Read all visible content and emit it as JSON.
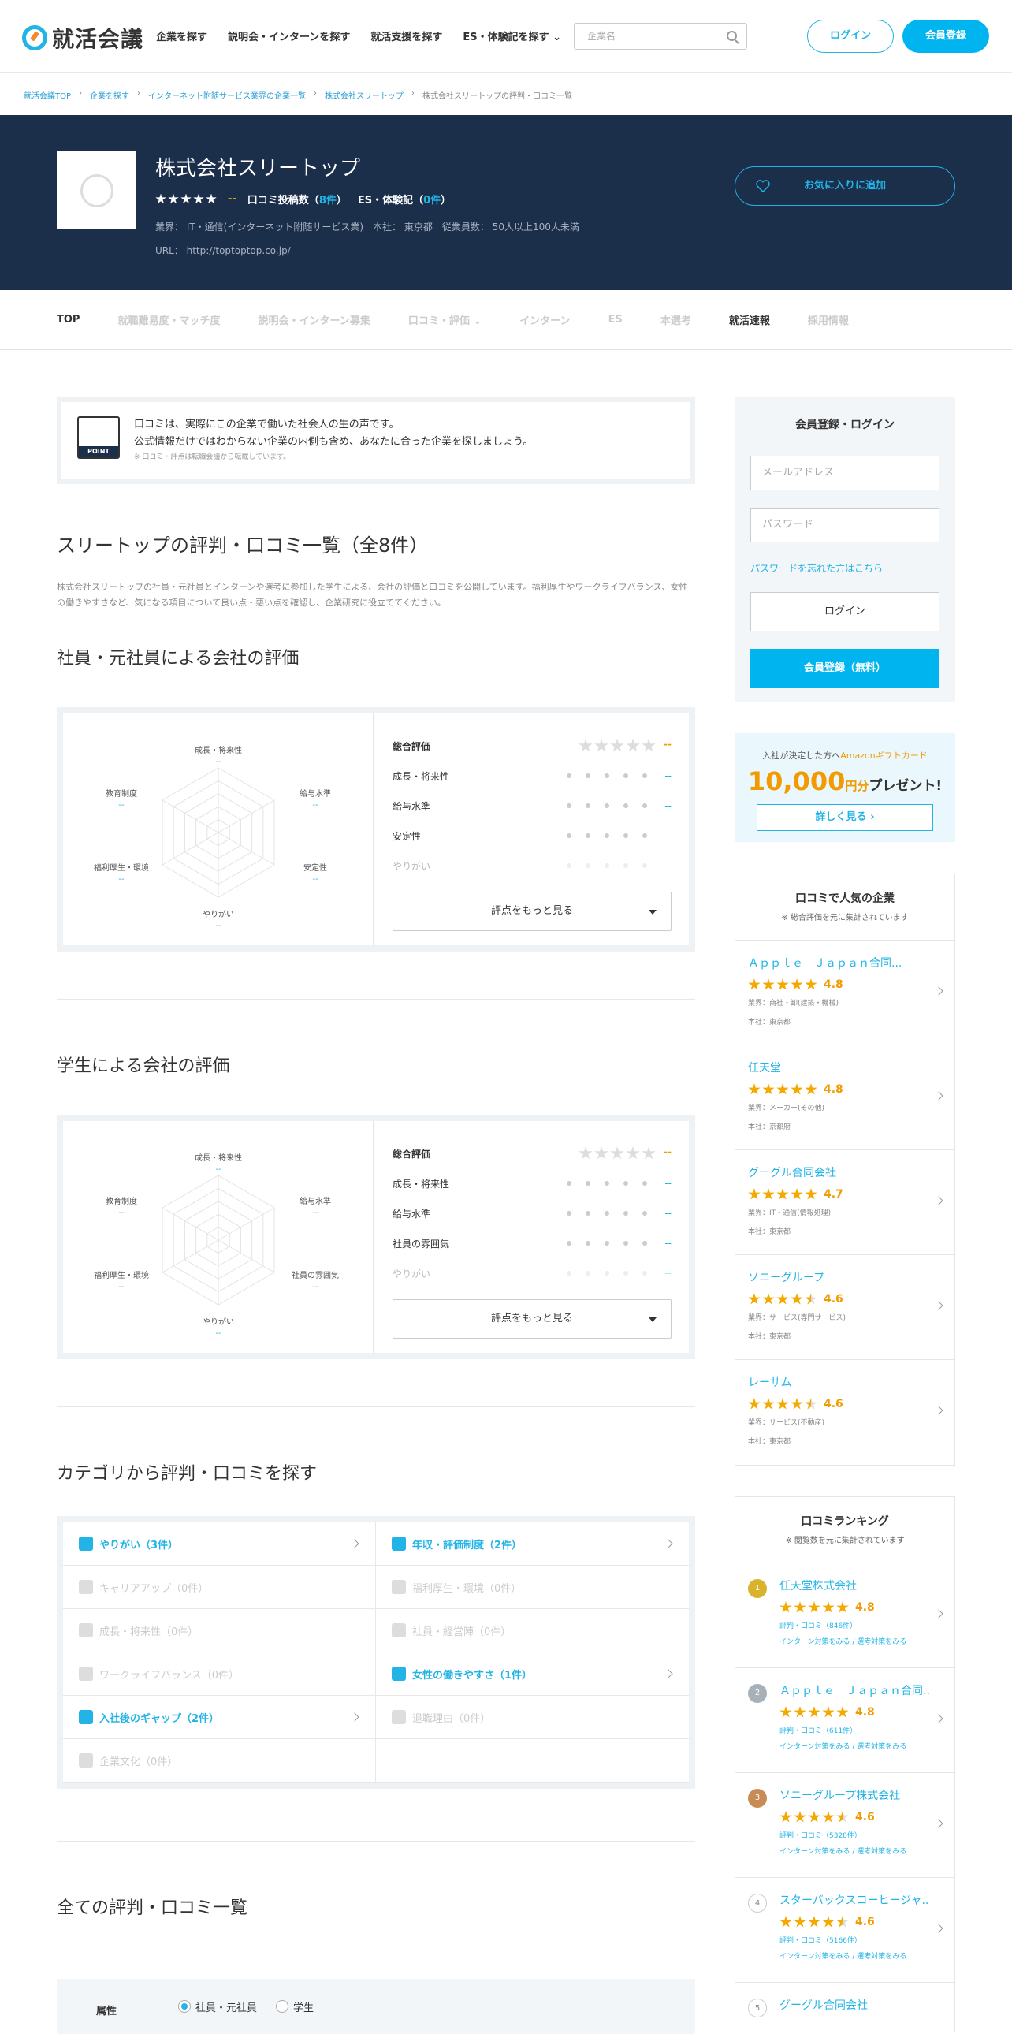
{
  "header": {
    "logo": "就活会議",
    "nav": [
      "企業を探す",
      "説明会・インターンを探す",
      "就活支援を探す",
      "ES・体験記を探す"
    ],
    "search_placeholder": "企業名",
    "login": "ログイン",
    "register": "会員登録"
  },
  "breadcrumb": [
    "就活会議TOP",
    "企業を探す",
    "インターネット附随サービス業界の企業一覧",
    "株式会社スリートップ",
    "株式会社スリートップの評判・口コミ一覧"
  ],
  "company": {
    "name": "株式会社スリートップ",
    "rating": "--",
    "review_label": "口コミ投稿数（",
    "review_count": "8件",
    "es_label": "ES・体験記（",
    "es_count": "0件",
    "industry": "業界： IT・通信(インターネット附随サービス業)　本社： 東京都　従業員数： 50人以上100人未満",
    "url": "URL： http://toptoptop.co.jp/",
    "fav_button": "お気に入りに追加"
  },
  "tabs": [
    "TOP",
    "就職難易度・マッチ度",
    "説明会・インターン募集",
    "口コミ・評価",
    "インターン",
    "ES",
    "本選考",
    "就活速報",
    "採用情報"
  ],
  "point": {
    "label": "POINT",
    "line1": "口コミは、実際にこの企業で働いた社会人の生の声です。",
    "line2": "公式情報だけではわからない企業の内側も含め、あなたに合った企業を探しましょう。",
    "note": "※ 口コミ・評点は転職会議から転載しています。"
  },
  "page_title": "スリートップの評判・口コミ一覧（全8件）",
  "page_desc": "株式会社スリートップの社員・元社員とインターンや選考に参加した学生による、会社の評価と口コミを公開しています。福利厚生やワークライフバランス、女性の働きやすさなど、気になる項目について良い点・悪い点を確認し、企業研究に役立ててください。",
  "employee_eval": {
    "title": "社員・元社員による会社の評価",
    "axes": [
      "成長・将来性",
      "給与水準",
      "安定性",
      "やりがい",
      "福利厚生・環境",
      "教育制度"
    ],
    "values": [
      "--",
      "--",
      "--",
      "--",
      "--",
      "--"
    ],
    "total_label": "総合評価",
    "total": "--",
    "rows": [
      {
        "label": "成長・将来性",
        "value": "--"
      },
      {
        "label": "給与水準",
        "value": "--"
      },
      {
        "label": "安定性",
        "value": "--"
      },
      {
        "label": "やりがい",
        "value": "--"
      }
    ],
    "more": "評点をもっと見る"
  },
  "student_eval": {
    "title": "学生による会社の評価",
    "axes": [
      "成長・将来性",
      "給与水準",
      "社員の雰囲気",
      "やりがい",
      "福利厚生・環境",
      "教育制度"
    ],
    "values": [
      "--",
      "--",
      "--",
      "--",
      "--",
      "--"
    ],
    "total_label": "総合評価",
    "total": "--",
    "rows": [
      {
        "label": "成長・将来性",
        "value": "--"
      },
      {
        "label": "給与水準",
        "value": "--"
      },
      {
        "label": "社員の雰囲気",
        "value": "--"
      },
      {
        "label": "やりがい",
        "value": "--"
      }
    ],
    "more": "評点をもっと見る"
  },
  "category": {
    "title": "カテゴリから評判・口コミを探す",
    "items": [
      {
        "label": "やりがい（3件）",
        "on": true
      },
      {
        "label": "年収・評価制度（2件）",
        "on": true
      },
      {
        "label": "キャリアアップ（0件）",
        "on": false
      },
      {
        "label": "福利厚生・環境（0件）",
        "on": false
      },
      {
        "label": "成長・将来性（0件）",
        "on": false
      },
      {
        "label": "社員・経営陣（0件）",
        "on": false
      },
      {
        "label": "ワークライフバランス（0件）",
        "on": false
      },
      {
        "label": "女性の働きやすさ（1件）",
        "on": true
      },
      {
        "label": "入社後のギャップ（2件）",
        "on": true
      },
      {
        "label": "退職理由（0件）",
        "on": false
      },
      {
        "label": "企業文化（0件）",
        "on": false
      },
      {
        "label": "",
        "on": false
      }
    ]
  },
  "all_reviews": {
    "title": "全ての評判・口コミ一覧",
    "attr_label": "属性",
    "opt1": "社員・元社員",
    "opt2": "学生"
  },
  "sidebar": {
    "login_title": "会員登録・ログイン",
    "email_placeholder": "メールアドレス",
    "password_placeholder": "パスワード",
    "forgot": "パスワードを忘れた方はこちら",
    "login": "ログイン",
    "register": "会員登録（無料）",
    "amazon_pre": "入社が決定した方へ",
    "amazon_brand": "Amazonギフトカード",
    "amazon_amount": "10,000",
    "amazon_yen": "円分",
    "amazon_present": "プレゼント!",
    "amazon_btn": "詳しく見る",
    "popular_title": "口コミで人気の企業",
    "popular_sub": "※ 総合評価を元に集計されています",
    "popular": [
      {
        "name": "Ａｐｐｌｅ　Ｊａｐａｎ合同...",
        "score": "4.8",
        "industry": "業界：商社・卸(建築・機械)",
        "hq": "本社：東京都",
        "stars": [
          1,
          1,
          1,
          1,
          1
        ]
      },
      {
        "name": "任天堂",
        "score": "4.8",
        "industry": "業界：メーカー(その他)",
        "hq": "本社：京都府",
        "stars": [
          1,
          1,
          1,
          1,
          1
        ]
      },
      {
        "name": "グーグル合同会社",
        "score": "4.7",
        "industry": "業界：IT・通信(情報処理)",
        "hq": "本社：東京都",
        "stars": [
          1,
          1,
          1,
          1,
          1
        ]
      },
      {
        "name": "ソニーグループ",
        "score": "4.6",
        "industry": "業界：サービス(専門サービス)",
        "hq": "本社：東京都",
        "stars": [
          1,
          1,
          1,
          1,
          0.5
        ]
      },
      {
        "name": "レーサム",
        "score": "4.6",
        "industry": "業界：サービス(不動産)",
        "hq": "本社：東京都",
        "stars": [
          1,
          1,
          1,
          1,
          0.5
        ]
      }
    ],
    "ranking_title": "口コミランキング",
    "ranking_sub": "※ 閲覧数を元に集計されています",
    "ranking": [
      {
        "no": "1",
        "name": "任天堂株式会社",
        "score": "4.8",
        "count": "評判・口コミ（846件）",
        "links": "インターン対策をみる / 選考対策をみる",
        "color": "#d9b32e",
        "stars": [
          1,
          1,
          1,
          1,
          1
        ]
      },
      {
        "no": "2",
        "name": "Ａｐｐｌｅ　Ｊａｐａｎ合同...",
        "score": "4.8",
        "count": "評判・口コミ（611件）",
        "links": "インターン対策をみる / 選考対策をみる",
        "color": "#a8b0b8",
        "stars": [
          1,
          1,
          1,
          1,
          1
        ]
      },
      {
        "no": "3",
        "name": "ソニーグループ株式会社",
        "score": "4.6",
        "count": "評判・口コミ（5328件）",
        "links": "インターン対策をみる / 選考対策をみる",
        "color": "#c98b55",
        "stars": [
          1,
          1,
          1,
          1,
          0.5
        ]
      },
      {
        "no": "4",
        "name": "スターバックスコーヒージャ...",
        "score": "4.6",
        "count": "評判・口コミ（5166件）",
        "links": "インターン対策をみる / 選考対策をみる",
        "color": "#fff",
        "stars": [
          1,
          1,
          1,
          1,
          0.5
        ]
      },
      {
        "no": "5",
        "name": "グーグル合同会社",
        "score": "",
        "count": "",
        "links": "",
        "color": "#fff",
        "stars": []
      }
    ]
  },
  "colors": {
    "accent": "#22b4e6",
    "navy": "#1b2e4a",
    "star": "#f4a900"
  }
}
